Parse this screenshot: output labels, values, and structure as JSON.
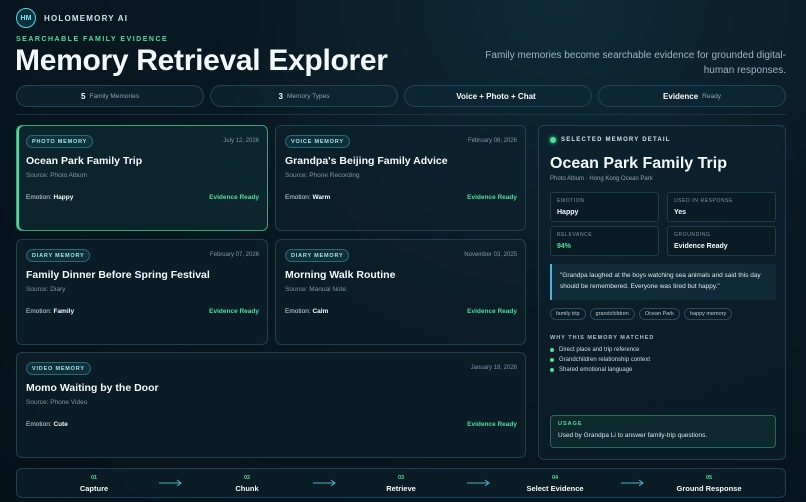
{
  "brand": {
    "logo_text": "HM",
    "name": "HOLOMEMORY AI"
  },
  "header": {
    "eyebrow": "SEARCHABLE FAMILY EVIDENCE",
    "title": "Memory Retrieval Explorer",
    "subtitle": "Family memories become searchable evidence for grounded digital-human responses."
  },
  "stats": [
    {
      "value": "5",
      "label": "Family Memories"
    },
    {
      "value": "3",
      "label": "Memory Types"
    },
    {
      "value": "Voice + Photo + Chat",
      "label": ""
    },
    {
      "value": "Evidence",
      "label": "Ready"
    }
  ],
  "memories": [
    {
      "tag": "PHOTO MEMORY",
      "date": "July 12, 2026",
      "title": "Ocean Park Family Trip",
      "source": "Source: Photo Album",
      "emotion_label": "Emotion:",
      "emotion": "Happy",
      "status": "Evidence Ready",
      "selected": true
    },
    {
      "tag": "VOICE MEMORY",
      "date": "February 08, 2026",
      "title": "Grandpa's Beijing Family Advice",
      "source": "Source: Phone Recording",
      "emotion_label": "Emotion:",
      "emotion": "Warm",
      "status": "Evidence Ready",
      "selected": false
    },
    {
      "tag": "DIARY MEMORY",
      "date": "February 07, 2026",
      "title": "Family Dinner Before Spring Festival",
      "source": "Source: Diary",
      "emotion_label": "Emotion:",
      "emotion": "Family",
      "status": "Evidence Ready",
      "selected": false
    },
    {
      "tag": "DIARY MEMORY",
      "date": "November 03, 2025",
      "title": "Morning Walk Routine",
      "source": "Source: Manual Note",
      "emotion_label": "Emotion:",
      "emotion": "Calm",
      "status": "Evidence Ready",
      "selected": false
    },
    {
      "tag": "VIDEO MEMORY",
      "date": "January 18, 2026",
      "title": "Momo Waiting by the Door",
      "source": "Source: Phone Video",
      "emotion_label": "Emotion:",
      "emotion": "Cute",
      "status": "Evidence Ready",
      "selected": false
    }
  ],
  "detail": {
    "label": "SELECTED MEMORY DETAIL",
    "title": "Ocean Park Family Trip",
    "meta": "Photo Album · Hong Kong Ocean Park",
    "metrics": [
      {
        "label": "EMOTION",
        "value": "Happy"
      },
      {
        "label": "USED IN RESPONSE",
        "value": "Yes"
      },
      {
        "label": "RELEVANCE",
        "value": "94%"
      },
      {
        "label": "GROUNDING",
        "value": "Evidence Ready"
      }
    ],
    "quote": "\"Grandpa laughed at the boys watching sea animals and said this day should be remembered. Everyone was tired but happy.\"",
    "tags": [
      "family trip",
      "grandchildren",
      "Ocean Park",
      "happy memory"
    ],
    "why_label": "WHY THIS MEMORY MATCHED",
    "why_items": [
      "Direct place and trip reference",
      "Grandchildren relationship context",
      "Shared emotional language"
    ],
    "usage_label": "USAGE",
    "usage_text": "Used by Grandpa Li to answer family-trip questions."
  },
  "pipeline": [
    {
      "num": "01",
      "name": "Capture"
    },
    {
      "num": "02",
      "name": "Chunk"
    },
    {
      "num": "03",
      "name": "Retrieve"
    },
    {
      "num": "04",
      "name": "Select Evidence"
    },
    {
      "num": "05",
      "name": "Ground Response"
    }
  ],
  "colors": {
    "accent_green": "#4ddf9c",
    "accent_cyan": "#4fd6e0",
    "background": "#081822"
  }
}
